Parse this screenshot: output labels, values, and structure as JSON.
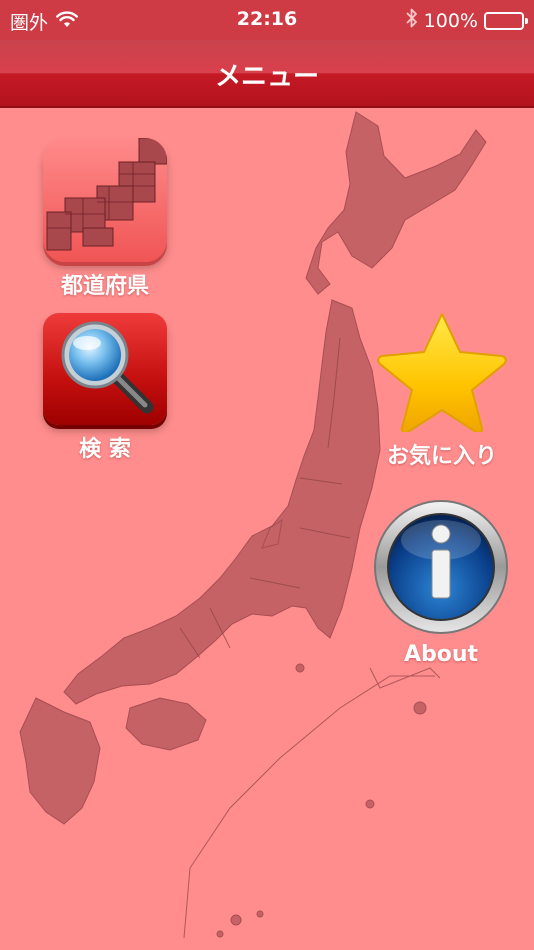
{
  "status_bar": {
    "carrier": "圏外",
    "time": "22:16",
    "battery_percent": "100%",
    "battery_level": 1.0
  },
  "nav": {
    "title": "メニュー"
  },
  "menu": {
    "prefectures": {
      "label": "都道府県",
      "icon": "japan-map-icon"
    },
    "search": {
      "label": "検 索",
      "icon": "magnifier-icon"
    },
    "favorites": {
      "label": "お気に入り",
      "icon": "star-icon"
    },
    "about": {
      "label": "About",
      "icon": "info-icon"
    }
  },
  "colors": {
    "background": "#ff8d8d",
    "nav_red": "#c51a26",
    "map_fill": "#c46266",
    "star_yellow": "#ffd11a",
    "info_blue": "#0a3f8a"
  }
}
